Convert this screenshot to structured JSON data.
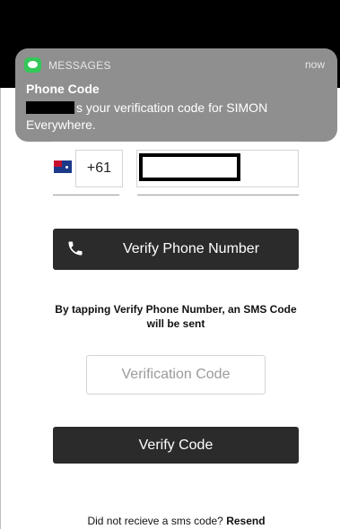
{
  "notification": {
    "app_name": "MESSAGES",
    "time": "now",
    "title": "Phone Code",
    "body": "s your verification code for SIMON Everywhere."
  },
  "phone": {
    "country_code": "+61",
    "country_flag": "australia-flag-icon",
    "phone_number_value": ""
  },
  "verify_phone_button": {
    "label": "Verify Phone Number",
    "icon": "phone-icon"
  },
  "instruction_text": "By tapping Verify Phone Number, an SMS Code will be sent",
  "verification_code": {
    "placeholder": "Verification Code",
    "value": ""
  },
  "verify_code_button": {
    "label": "Verify Code"
  },
  "resend": {
    "prompt": "Did not recieve a sms code?",
    "link_label": "Resend"
  },
  "colors": {
    "button_bg": "#2b2b2b",
    "notification_bg": "#8f8f8f",
    "messages_green": "#34c759"
  }
}
